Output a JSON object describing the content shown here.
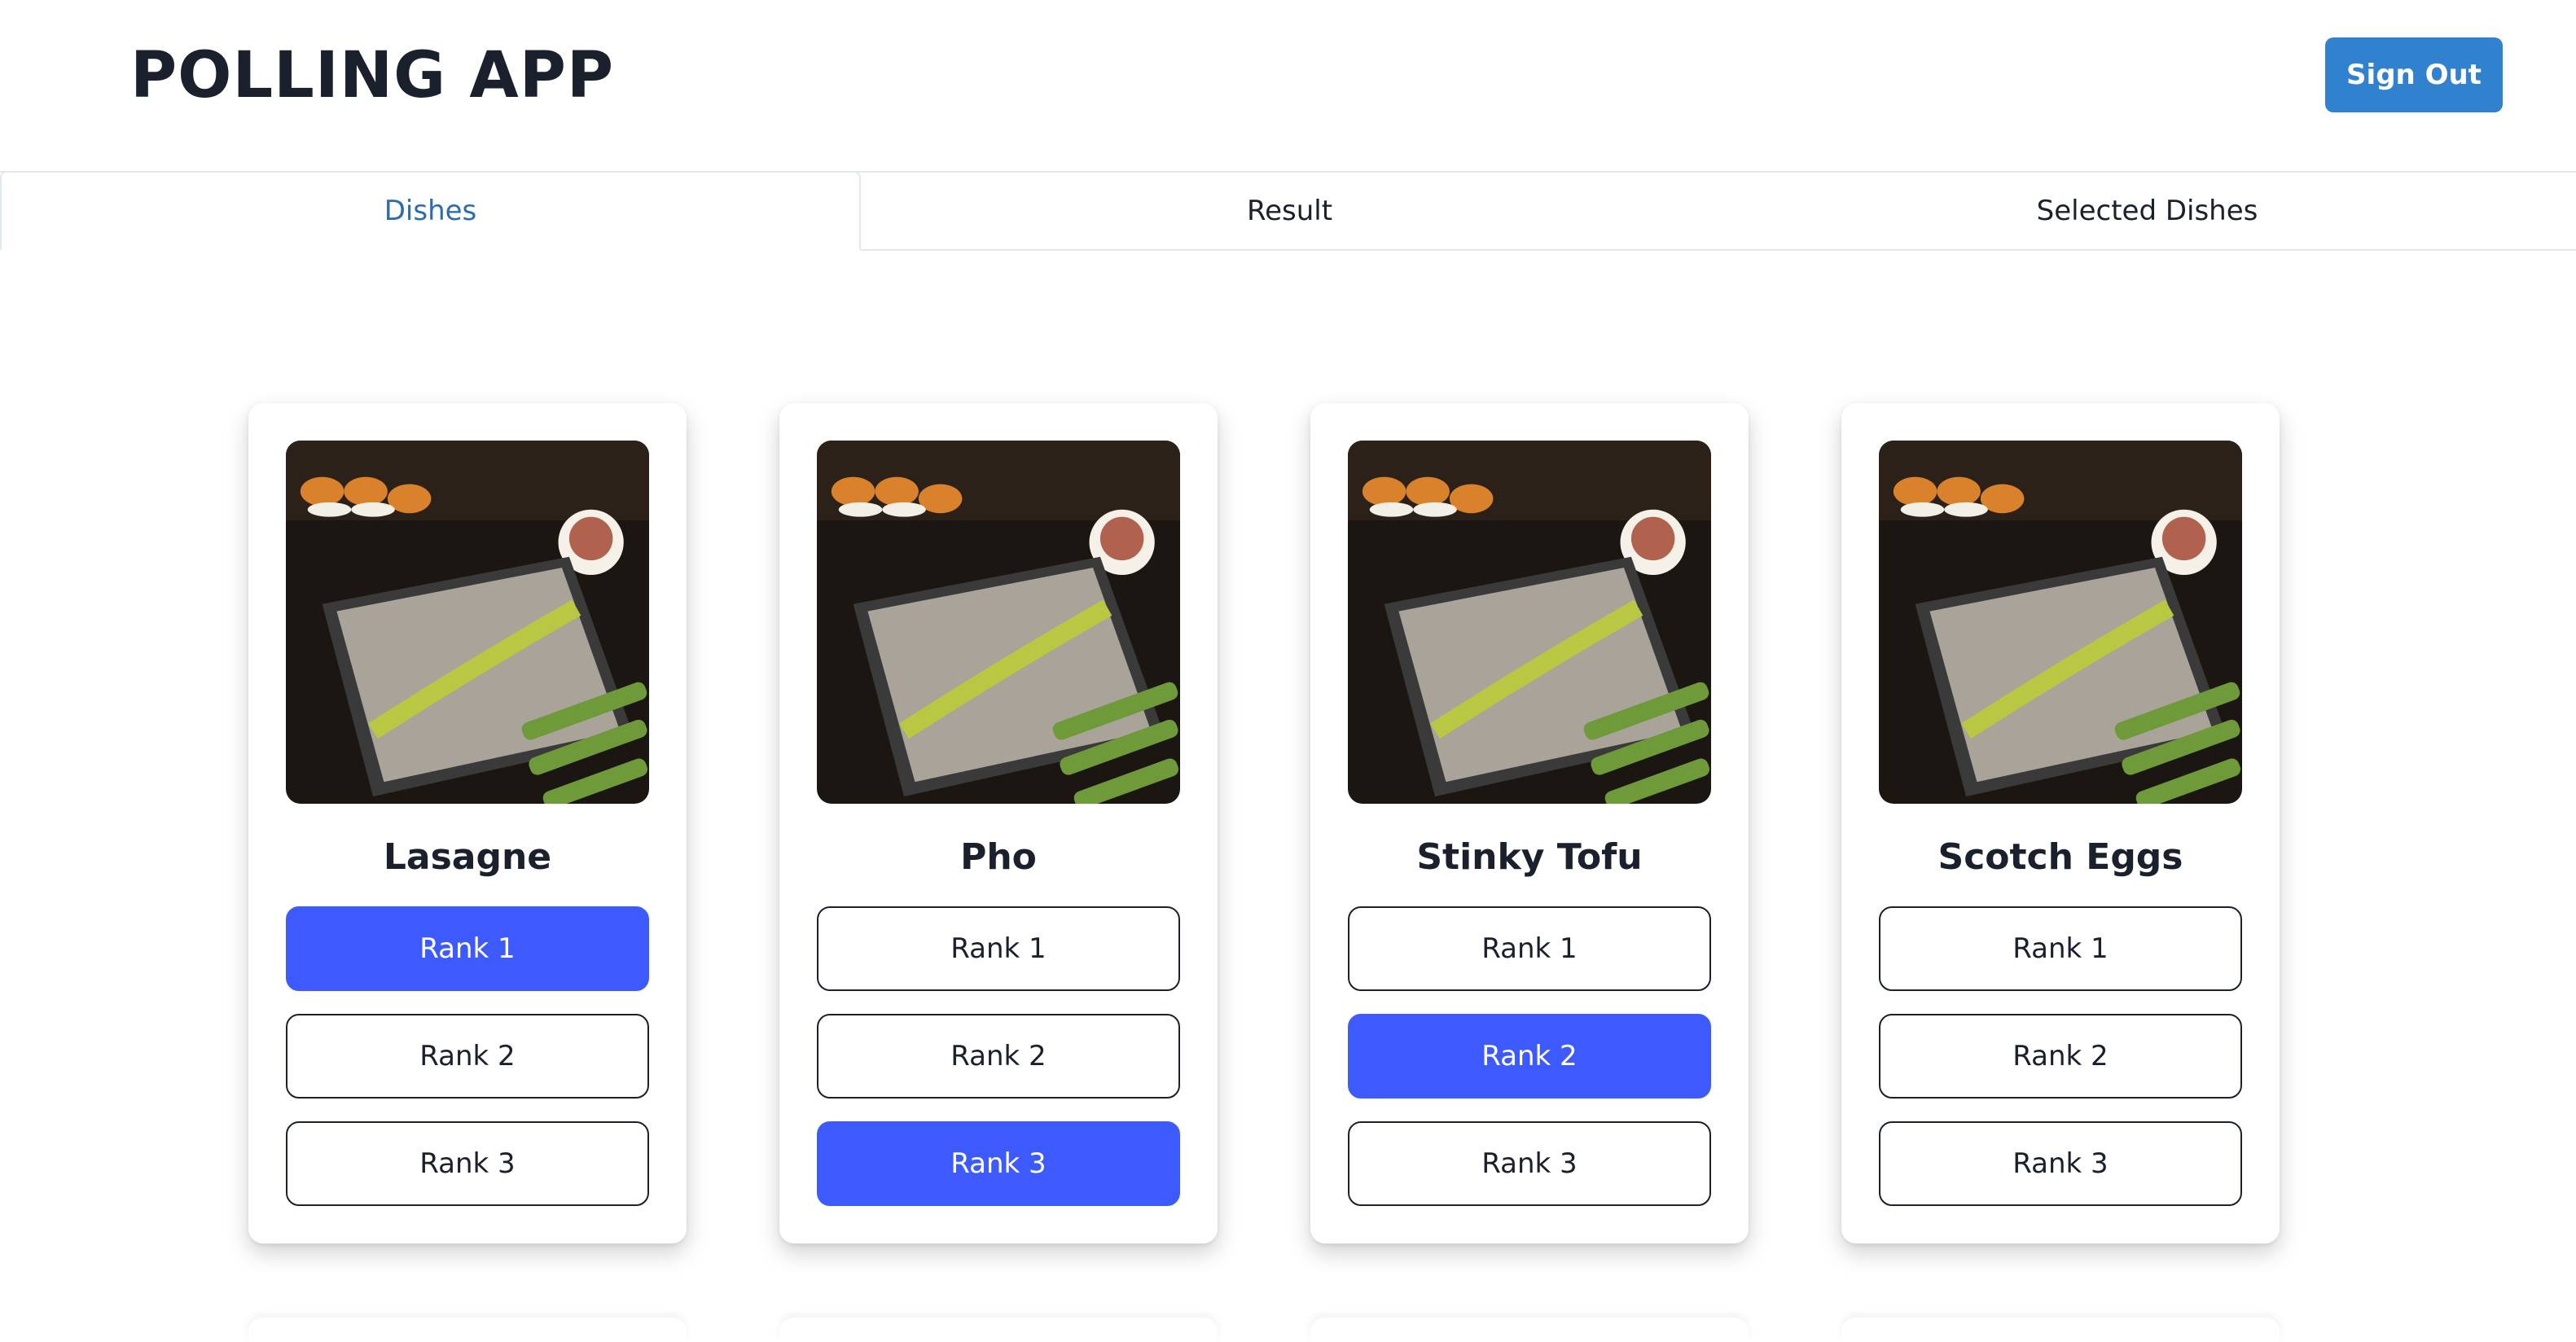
{
  "header": {
    "title": "POLLING APP",
    "signout_label": "Sign Out"
  },
  "tabs": [
    {
      "label": "Dishes",
      "active": true
    },
    {
      "label": "Result",
      "active": false
    },
    {
      "label": "Selected Dishes",
      "active": false
    }
  ],
  "colors": {
    "accent": "#3182ce",
    "selected_rank": "#3d5afe",
    "active_tab_text": "#2b6cb0"
  },
  "dishes": [
    {
      "name": "Lasagne",
      "ranks": [
        "Rank 1",
        "Rank 2",
        "Rank 3"
      ],
      "selected_rank": 1
    },
    {
      "name": "Pho",
      "ranks": [
        "Rank 1",
        "Rank 2",
        "Rank 3"
      ],
      "selected_rank": 3
    },
    {
      "name": "Stinky Tofu",
      "ranks": [
        "Rank 1",
        "Rank 2",
        "Rank 3"
      ],
      "selected_rank": 2
    },
    {
      "name": "Scotch Eggs",
      "ranks": [
        "Rank 1",
        "Rank 2",
        "Rank 3"
      ],
      "selected_rank": null
    }
  ]
}
